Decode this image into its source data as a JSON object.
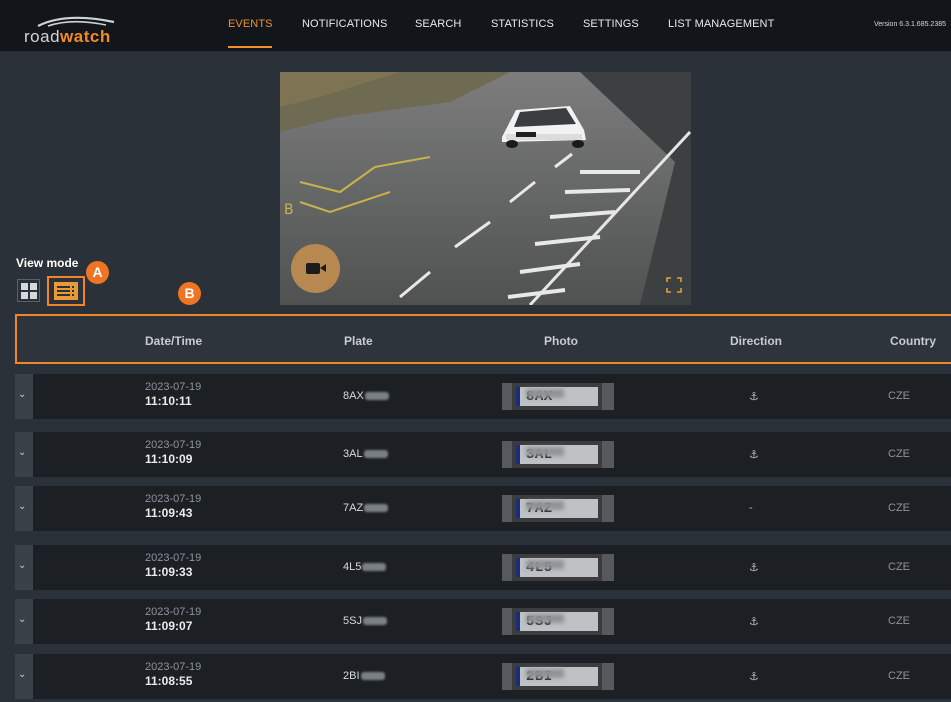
{
  "app": {
    "logo_text_a": "road",
    "logo_text_b": "watch",
    "version": "Version 6.3.1.685.2385"
  },
  "nav": {
    "items": [
      {
        "label": "EVENTS",
        "active": true
      },
      {
        "label": "NOTIFICATIONS",
        "active": false
      },
      {
        "label": "SEARCH",
        "active": false
      },
      {
        "label": "STATISTICS",
        "active": false
      },
      {
        "label": "SETTINGS",
        "active": false
      },
      {
        "label": "LIST MANAGEMENT",
        "active": false
      }
    ]
  },
  "camera": {
    "record_icon": "video-camera-icon",
    "fullscreen_icon": "fullscreen-icon"
  },
  "view_mode": {
    "label": "View mode",
    "options": [
      {
        "icon": "grid-view-icon",
        "selected": false
      },
      {
        "icon": "list-view-icon",
        "selected": true
      }
    ]
  },
  "callouts": {
    "a": "A",
    "b": "B"
  },
  "table": {
    "columns": [
      "Date/Time",
      "Plate",
      "Photo",
      "Direction",
      "Country"
    ],
    "rows": [
      {
        "date": "2023-07-19",
        "time": "11:10:11",
        "plate": "8AX",
        "photo_plate": "8AX",
        "direction": "⚓",
        "country": "CZE"
      },
      {
        "date": "2023-07-19",
        "time": "11:10:09",
        "plate": "3AL",
        "photo_plate": "3AL",
        "direction": "⚓",
        "country": "CZE"
      },
      {
        "date": "2023-07-19",
        "time": "11:09:43",
        "plate": "7AZ",
        "photo_plate": "7AZ",
        "direction": "-",
        "country": "CZE"
      },
      {
        "date": "2023-07-19",
        "time": "11:09:33",
        "plate": "4L5",
        "photo_plate": "4L5",
        "direction": "⚓",
        "country": "CZE"
      },
      {
        "date": "2023-07-19",
        "time": "11:09:07",
        "plate": "5SJ",
        "photo_plate": "5SJ",
        "direction": "⚓",
        "country": "CZE"
      },
      {
        "date": "2023-07-19",
        "time": "11:08:55",
        "plate": "2BI",
        "photo_plate": "2BI",
        "direction": "⚓",
        "country": "CZE"
      }
    ]
  },
  "colors": {
    "accent": "#f0902c",
    "background": "#2b3138",
    "topbar": "#121519",
    "row": "#1c2024"
  }
}
